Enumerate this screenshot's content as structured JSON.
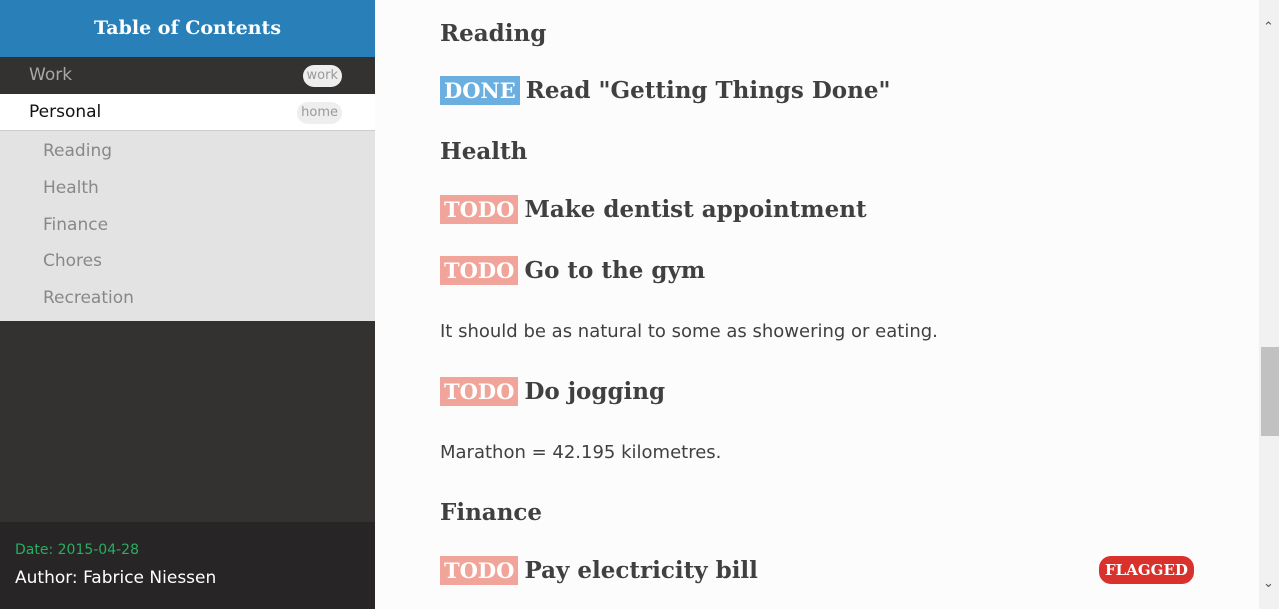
{
  "sidebar": {
    "title": "Table of Contents",
    "items": [
      {
        "label": "Work",
        "tag": "work"
      },
      {
        "label": "Personal",
        "tag": "home"
      }
    ],
    "subitems": [
      "Reading",
      "Health",
      "Finance",
      "Chores",
      "Recreation"
    ],
    "date": "Date: 2015-04-28",
    "author": "Author: Fabrice Niessen"
  },
  "main": {
    "h_reading": "Reading",
    "t1": {
      "kw": "DONE",
      "text": "Read \"Getting Things Done\""
    },
    "h_health": "Health",
    "t2": {
      "kw": "TODO",
      "text": "Make dentist appointment"
    },
    "t3": {
      "kw": "TODO",
      "text": "Go to the gym"
    },
    "p1": "It should be as natural to some as showering or eating.",
    "t4": {
      "kw": "TODO",
      "text": "Do jogging"
    },
    "p2": "Marathon = 42.195 kilometres.",
    "h_finance": "Finance",
    "t5": {
      "kw": "TODO",
      "text": "Pay electricity bill",
      "flag": "FLAGGED"
    }
  }
}
